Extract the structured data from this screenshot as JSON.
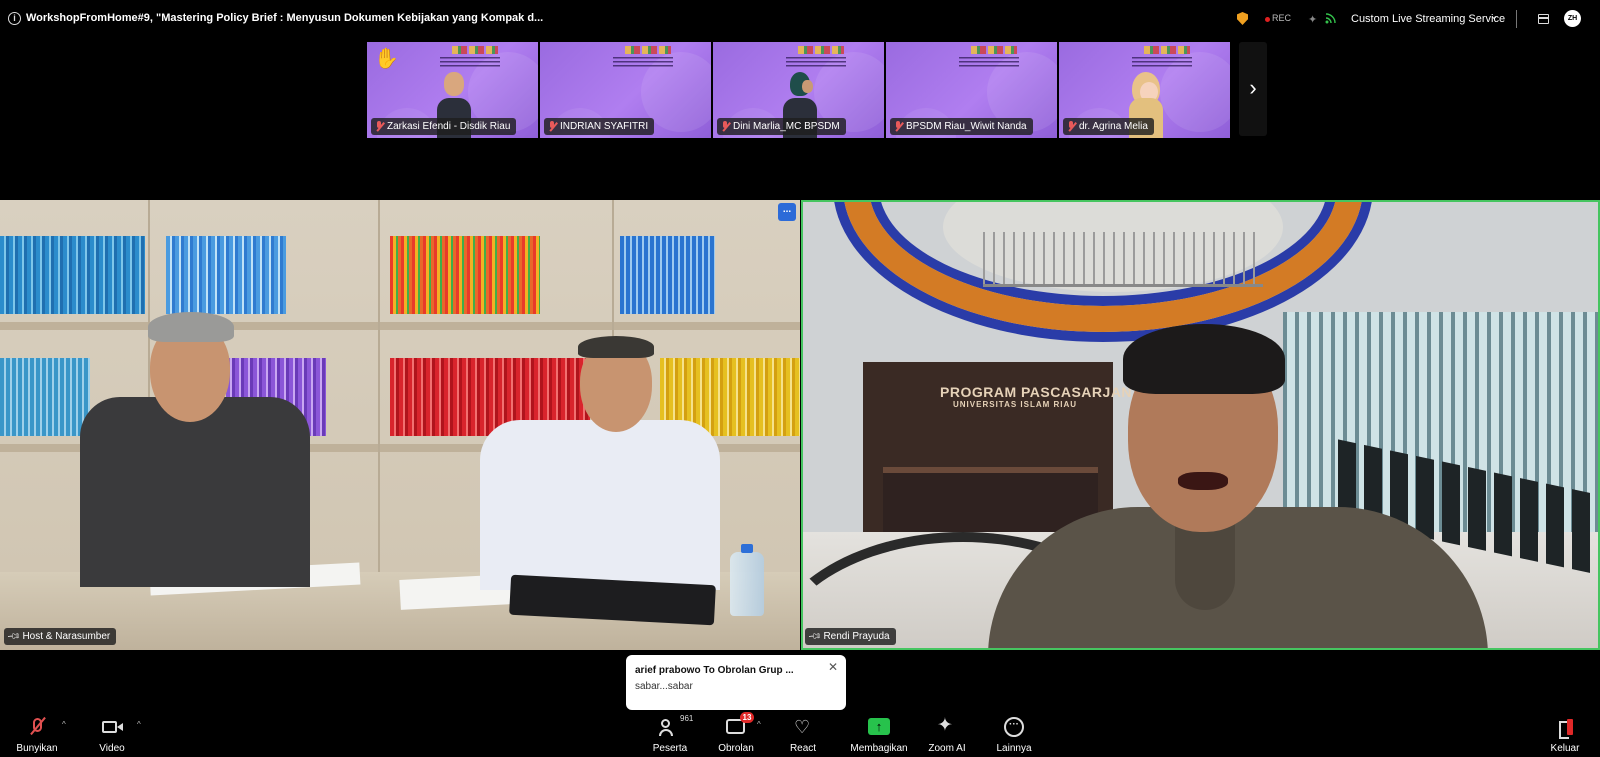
{
  "window": {
    "title": "WorkshopFromHome#9, \"Mastering Policy Brief : Menyusun Dokumen Kebijakan yang Kompak d...",
    "rec_label": "REC",
    "stream_label": "Custom Live Streaming Service",
    "avatar_initials": "ZH"
  },
  "gallery": {
    "participants": [
      {
        "name": "Zarkasi Efendi - Disdik Riau",
        "hand_raised": true
      },
      {
        "name": "INDRIAN SYAFITRI",
        "hand_raised": false
      },
      {
        "name": "Dini Marlia_MC BPSDM",
        "hand_raised": false
      },
      {
        "name": "BPSDM Riau_Wiwit Nanda",
        "hand_raised": false
      },
      {
        "name": "dr. Agrina Melia",
        "hand_raised": false
      }
    ]
  },
  "videos": {
    "left_label": "Host & Narasumber",
    "left_more": "...",
    "right_label": "Rendi Prayuda",
    "right_sign_line1": "PROGRAM PASCASARJANA",
    "right_sign_line2": "UNIVERSITAS ISLAM RIAU"
  },
  "chat_notification": {
    "from": "arief prabowo To Obrolan Grup ...",
    "message": "sabar...sabar"
  },
  "toolbar": {
    "unmute": "Bunyikan",
    "video": "Video",
    "participants": "Peserta",
    "participants_count": "961",
    "chat": "Obrolan",
    "chat_badge": "13",
    "react": "React",
    "share": "Membagikan",
    "zoom_ai": "Zoom AI",
    "more": "Lainnya",
    "leave": "Keluar"
  },
  "colors": {
    "active_speaker_border": "#46c560",
    "share_green": "#27c24c",
    "badge_red": "#e02828",
    "gallery_purple": "#a575ea"
  }
}
